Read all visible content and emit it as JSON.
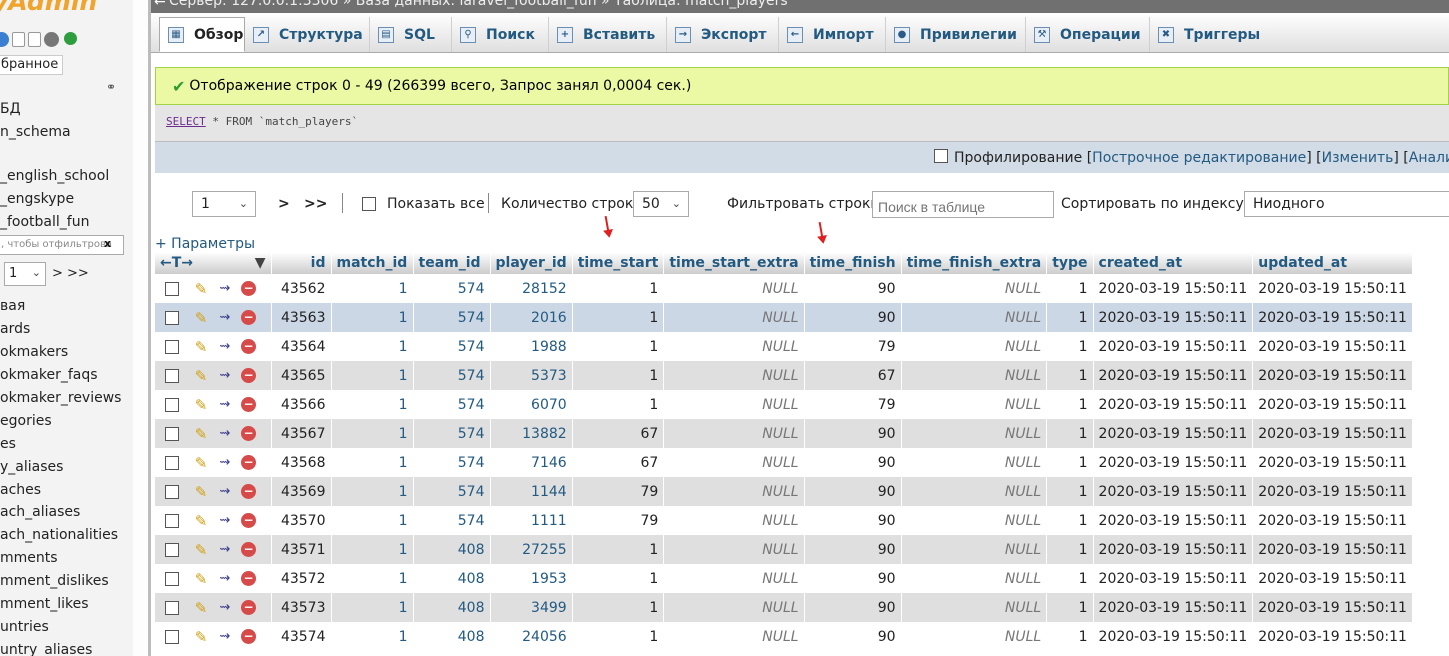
{
  "left": {
    "logo": "yAdmin",
    "favorites": "бранное",
    "databases": [
      "БД",
      "n_schema",
      "_english_school",
      "_engskype",
      "_football_fun"
    ],
    "filter_placeholder": ", чтобы отфильтрова",
    "filter_clear": "x",
    "page_select": "1",
    "page_next": "> >>",
    "tables": [
      "вая",
      "ards",
      "okmakers",
      "okmaker_faqs",
      "okmaker_reviews",
      "egories",
      "es",
      "y_aliases",
      "aches",
      "ach_aliases",
      "ach_nationalities",
      "mments",
      "mment_dislikes",
      "mment_likes",
      "untries",
      "untry_aliases"
    ]
  },
  "breadcrumb": {
    "back": "←",
    "text": "Сервер: 127.0.0.1:3306 » Вaзa данных: laravel_football_fun » Таблица: match_players"
  },
  "tabs": [
    {
      "label": "Обзор",
      "icon": "browse-icon"
    },
    {
      "label": "Структура",
      "icon": "structure-icon"
    },
    {
      "label": "SQL",
      "icon": "sql-icon"
    },
    {
      "label": "Поиск",
      "icon": "search-icon"
    },
    {
      "label": "Вставить",
      "icon": "insert-icon"
    },
    {
      "label": "Экспорт",
      "icon": "export-icon"
    },
    {
      "label": "Импорт",
      "icon": "import-icon"
    },
    {
      "label": "Привилегии",
      "icon": "privileges-icon"
    },
    {
      "label": "Операции",
      "icon": "operations-icon"
    },
    {
      "label": "Триггеры",
      "icon": "triggers-icon"
    }
  ],
  "message": {
    "success": "Отображение строк 0 - 49 (266399 всего, Запрос занял 0,0004 сек.)"
  },
  "query": {
    "keyword_select": "SELECT",
    "rest": " * FROM `match_players`"
  },
  "sql_actions": {
    "profiling": "Профилирование",
    "bracket_open": "[",
    "inline_edit": "Построчное редактирование",
    "sep": "] [",
    "edit": "Изменить",
    "explain": "Анализ SQL"
  },
  "nav": {
    "page": "1",
    "next": ">",
    "last": ">>",
    "show_all": "Показать все",
    "rows_label": "Количество строк:",
    "rows_value": "50",
    "filter_label": "Фильтровать строки:",
    "filter_placeholder": "Поиск в таблице",
    "sort_label": "Сортировать по индексу:",
    "sort_value": "Ниодного"
  },
  "params_link": "+ Параметры",
  "table": {
    "toggle_arrows": "←T→",
    "columns": [
      "id",
      "match_id",
      "team_id",
      "player_id",
      "time_start",
      "time_start_extra",
      "time_finish",
      "time_finish_extra",
      "type",
      "created_at",
      "updated_at"
    ],
    "rows": [
      [
        "43562",
        "1",
        "574",
        "28152",
        "1",
        "NULL",
        "90",
        "NULL",
        "1",
        "2020-03-19 15:50:11",
        "2020-03-19 15:50:11"
      ],
      [
        "43563",
        "1",
        "574",
        "2016",
        "1",
        "NULL",
        "90",
        "NULL",
        "1",
        "2020-03-19 15:50:11",
        "2020-03-19 15:50:11"
      ],
      [
        "43564",
        "1",
        "574",
        "1988",
        "1",
        "NULL",
        "79",
        "NULL",
        "1",
        "2020-03-19 15:50:11",
        "2020-03-19 15:50:11"
      ],
      [
        "43565",
        "1",
        "574",
        "5373",
        "1",
        "NULL",
        "67",
        "NULL",
        "1",
        "2020-03-19 15:50:11",
        "2020-03-19 15:50:11"
      ],
      [
        "43566",
        "1",
        "574",
        "6070",
        "1",
        "NULL",
        "79",
        "NULL",
        "1",
        "2020-03-19 15:50:11",
        "2020-03-19 15:50:11"
      ],
      [
        "43567",
        "1",
        "574",
        "13882",
        "67",
        "NULL",
        "90",
        "NULL",
        "1",
        "2020-03-19 15:50:11",
        "2020-03-19 15:50:11"
      ],
      [
        "43568",
        "1",
        "574",
        "7146",
        "67",
        "NULL",
        "90",
        "NULL",
        "1",
        "2020-03-19 15:50:11",
        "2020-03-19 15:50:11"
      ],
      [
        "43569",
        "1",
        "574",
        "1144",
        "79",
        "NULL",
        "90",
        "NULL",
        "1",
        "2020-03-19 15:50:11",
        "2020-03-19 15:50:11"
      ],
      [
        "43570",
        "1",
        "574",
        "1111",
        "79",
        "NULL",
        "90",
        "NULL",
        "1",
        "2020-03-19 15:50:11",
        "2020-03-19 15:50:11"
      ],
      [
        "43571",
        "1",
        "408",
        "27255",
        "1",
        "NULL",
        "90",
        "NULL",
        "1",
        "2020-03-19 15:50:11",
        "2020-03-19 15:50:11"
      ],
      [
        "43572",
        "1",
        "408",
        "1953",
        "1",
        "NULL",
        "90",
        "NULL",
        "1",
        "2020-03-19 15:50:11",
        "2020-03-19 15:50:11"
      ],
      [
        "43573",
        "1",
        "408",
        "3499",
        "1",
        "NULL",
        "90",
        "NULL",
        "1",
        "2020-03-19 15:50:11",
        "2020-03-19 15:50:11"
      ],
      [
        "43574",
        "1",
        "408",
        "24056",
        "1",
        "NULL",
        "90",
        "NULL",
        "1",
        "2020-03-19 15:50:11",
        "2020-03-19 15:50:11"
      ]
    ]
  },
  "colors": {
    "link": "#235a81",
    "success_bg": "#ebf8a4",
    "highlight_row": "#ccd7e6",
    "annotation_arrow": "#e02020"
  }
}
